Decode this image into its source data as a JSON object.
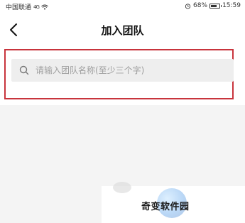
{
  "status_bar": {
    "carrier": "中国联通",
    "network": "4G",
    "battery": "68%",
    "battery_level": 0.68,
    "time": "15:59"
  },
  "header": {
    "title": "加入团队",
    "back_icon": "chevron-left-icon"
  },
  "search": {
    "placeholder": "请输入团队名称(至少三个字)",
    "value": "",
    "icon": "search-icon",
    "highlight_color": "#c8343c"
  },
  "watermark": {
    "text": "奇变软件园"
  }
}
